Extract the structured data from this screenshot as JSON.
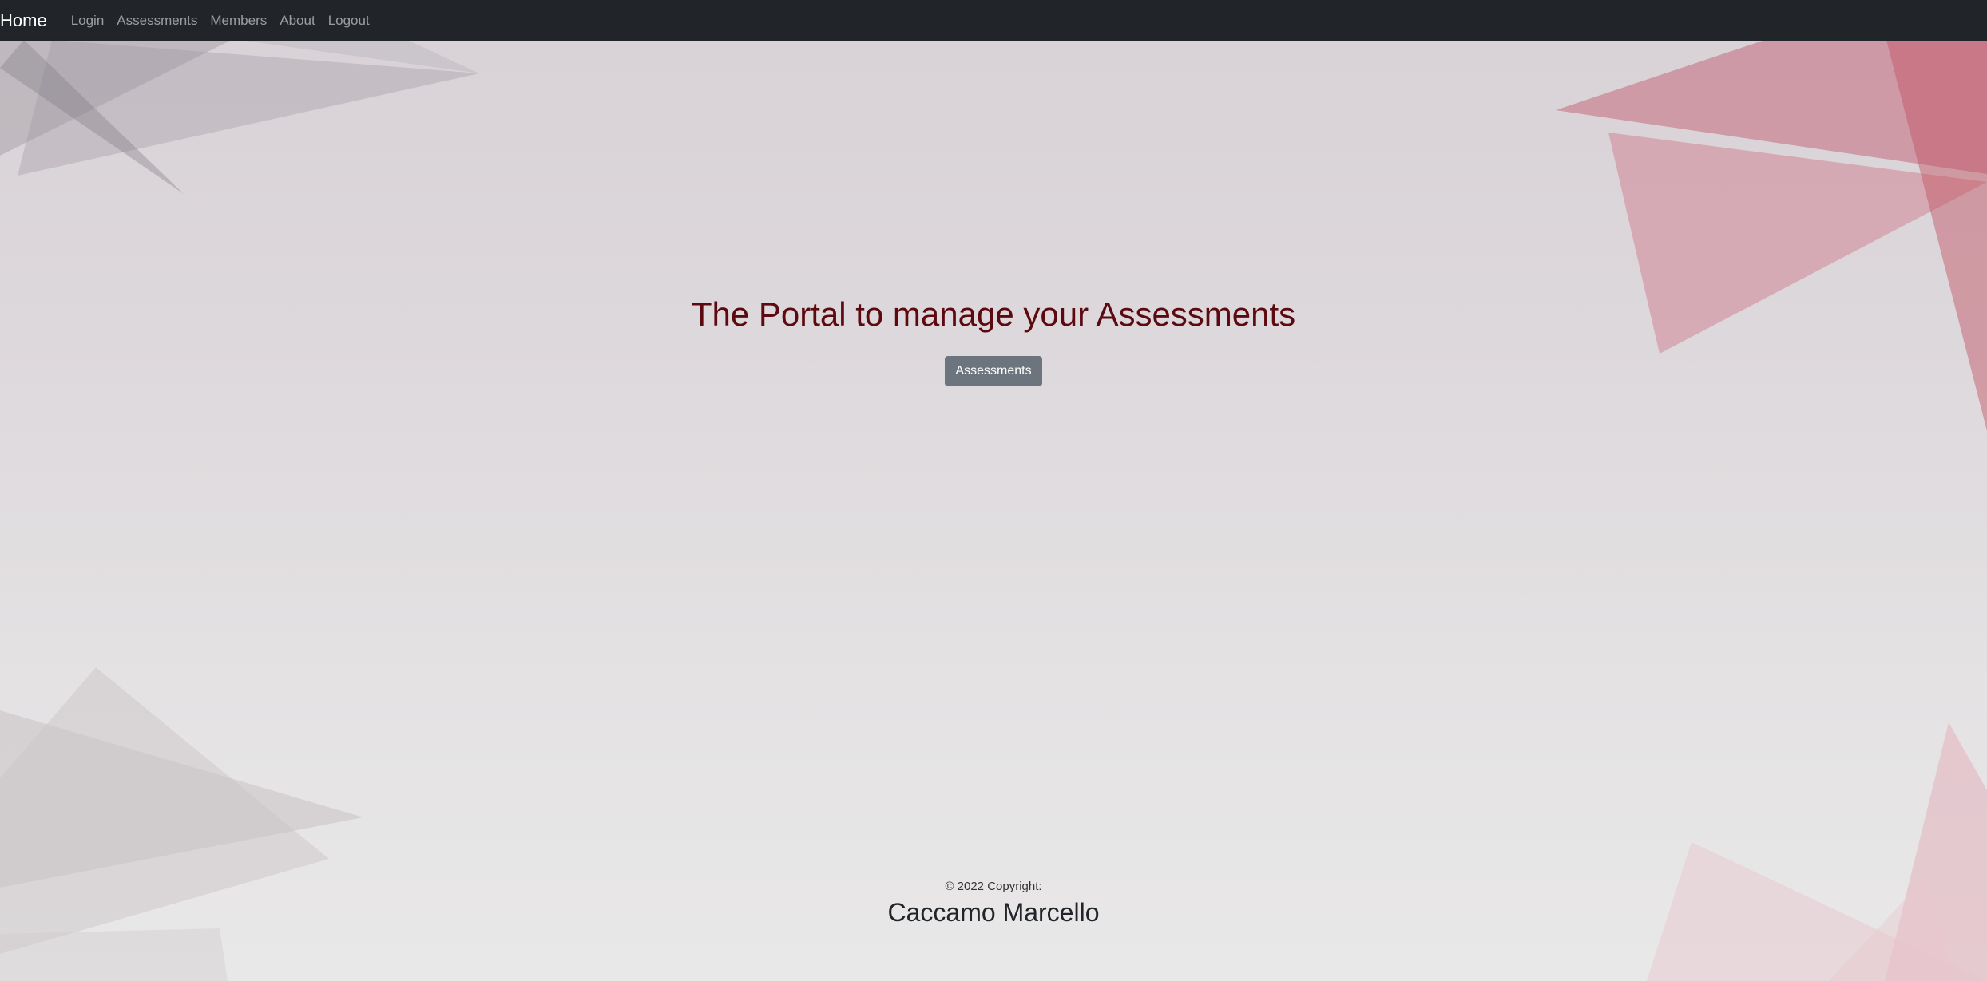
{
  "navbar": {
    "brand": "Home",
    "links": [
      "Login",
      "Assessments",
      "Members",
      "About",
      "Logout"
    ]
  },
  "hero": {
    "title": "The Portal to manage your Assessments",
    "button_label": "Assessments"
  },
  "footer": {
    "copyright": "© 2022 Copyright:",
    "author": "Caccamo Marcello"
  },
  "colors": {
    "navbar_bg": "#212529",
    "title": "#5c0a10",
    "button_bg": "#6c757d"
  }
}
